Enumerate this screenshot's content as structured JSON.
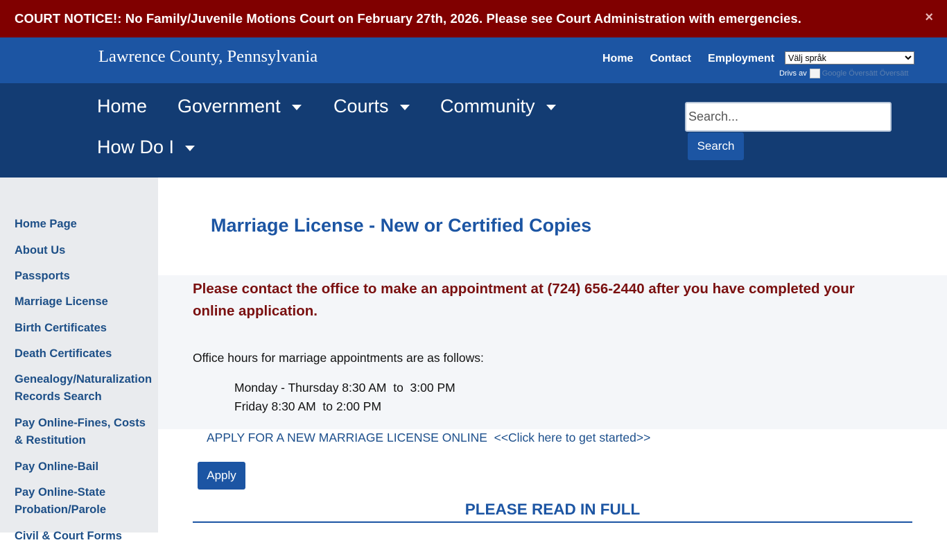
{
  "notice": {
    "text": "COURT NOTICE!:  No Family/Juvenile Motions Court on February 27th, 2026.  Please see Court Administration with emergencies.",
    "close": "×"
  },
  "header": {
    "site_title": "Lawrence County, Pennsylvania",
    "links": [
      "Home",
      "Contact",
      "Employment"
    ],
    "language_select": "Välj språk",
    "powered_label": "Drivs av",
    "powered_by": "Google Översätt Översätt"
  },
  "nav": {
    "items": [
      "Home",
      "Government",
      "Courts",
      "Community",
      "How Do I"
    ],
    "search_placeholder": "Search...",
    "search_button": "Search"
  },
  "sidebar": {
    "items": [
      "Home Page",
      "About Us",
      "Passports",
      "Marriage License",
      "Birth Certificates",
      "Death Certificates",
      "Genealogy/Naturalization Records Search",
      "Pay Online-Fines, Costs & Restitution",
      "Pay Online-Bail",
      "Pay Online-State Probation/Parole",
      "Civil & Court Forms"
    ]
  },
  "content": {
    "title": "Marriage License - New or Certified Copies",
    "alert": "Please contact the office to make an appointment at (724) 656-2440 after you have completed your online application.",
    "hours_intro": "Office hours for marriage appointments are as follows:",
    "hours": [
      "Monday - Thursday 8:30 AM  to  3:00 PM",
      "Friday 8:30 AM  to 2:00 PM"
    ],
    "apply_link": "APPLY FOR A NEW MARRIAGE LICENSE ONLINE  <<Click here to get started>>",
    "apply_button": "Apply",
    "read_heading": "PLEASE READ IN FULL"
  },
  "colors": {
    "notice_bg": "#800000",
    "header_bg": "#1c55a3",
    "nav_bg": "#133c73",
    "sidebar_bg": "#e9ebee",
    "alert_text": "#7a1010"
  }
}
